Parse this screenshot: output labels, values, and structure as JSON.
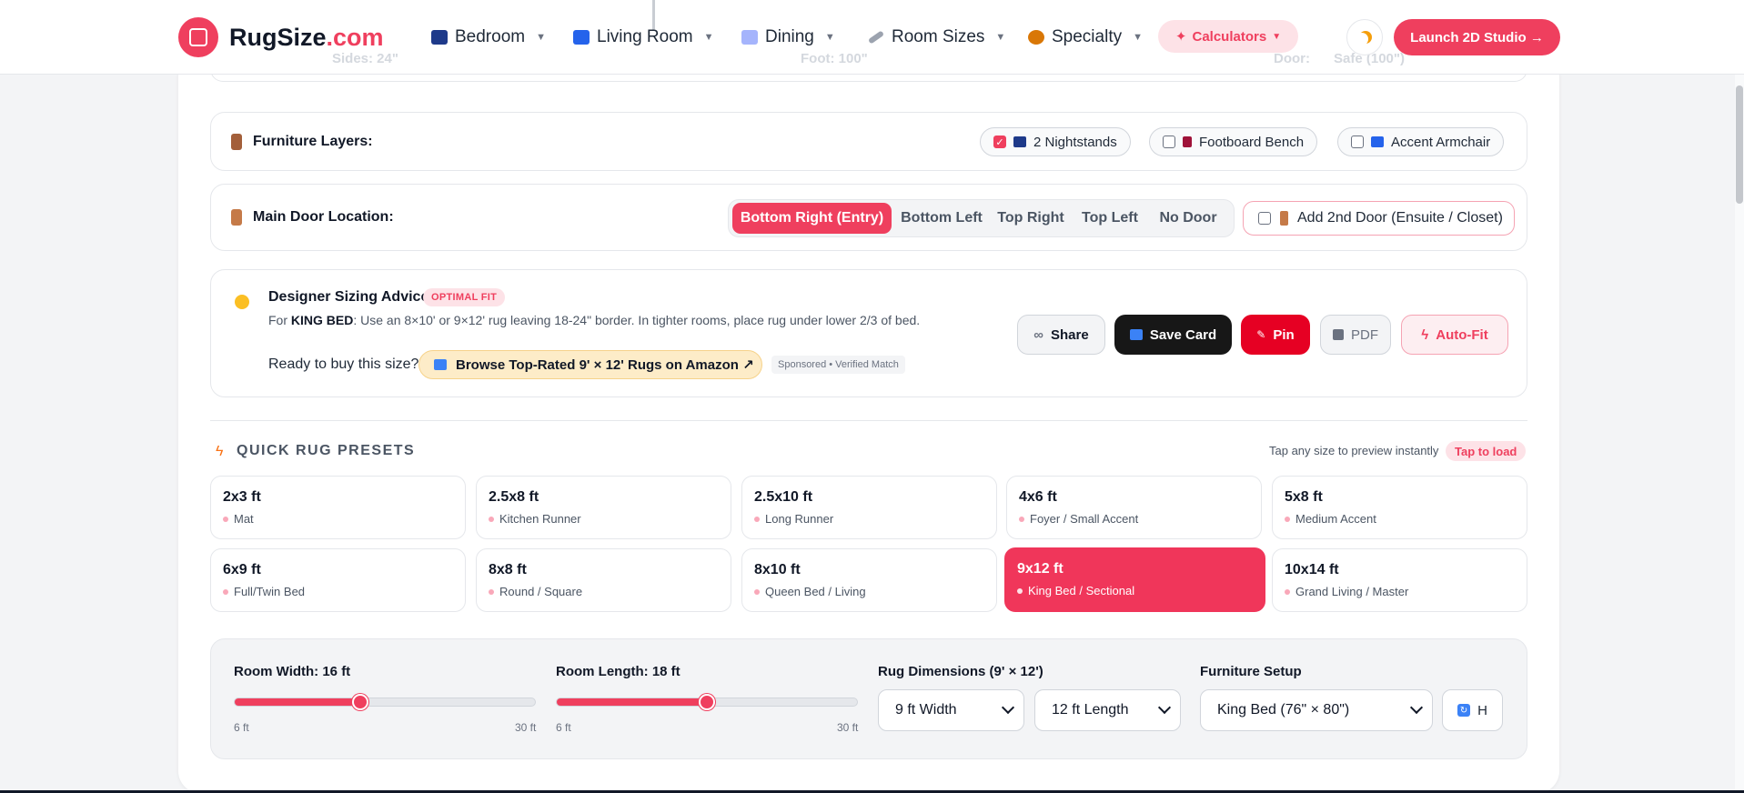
{
  "header": {
    "brand_name": "RugSize",
    "brand_suffix": ".com",
    "nav": [
      {
        "label": "Bedroom",
        "icon": "bed-icon"
      },
      {
        "label": "Living Room",
        "icon": "sofa-icon"
      },
      {
        "label": "Dining",
        "icon": "dining-icon"
      },
      {
        "label": "Room Sizes",
        "icon": "ruler-icon"
      },
      {
        "label": "Specialty",
        "icon": "specialty-icon"
      }
    ],
    "calculators_label": "Calculators",
    "launch_label": "Launch 2D Studio →",
    "background_labels": [
      "Sides: 24\"",
      "Foot: 100\"",
      "Door:",
      "Safe (100\")"
    ]
  },
  "furniture_layers": {
    "title": "Furniture Layers:",
    "items": [
      {
        "label": "2 Nightstands",
        "checked": true
      },
      {
        "label": "Footboard Bench",
        "checked": false
      },
      {
        "label": "Accent Armchair",
        "checked": false
      }
    ]
  },
  "door": {
    "title": "Main Door Location:",
    "options": [
      "Bottom Right (Entry)",
      "Bottom Left",
      "Top Right",
      "Top Left",
      "No Door"
    ],
    "selected": "Bottom Right (Entry)",
    "second_door_label": "Add 2nd Door (Ensuite / Closet)"
  },
  "advice": {
    "title": "Designer Sizing Advice",
    "badge": "OPTIMAL FIT",
    "text_prefix": "For ",
    "text_bold": "KING BED",
    "text_rest": ": Use an 8×10' or 9×12' rug leaving 18-24\" border. In tighter rooms, place rug under lower 2/3 of bed.",
    "ready_label": "Ready to buy this size?",
    "amazon_label": "Browse Top-Rated 9' × 12' Rugs on Amazon ↗",
    "sponsored_label": "Sponsored • Verified Match",
    "actions": {
      "share": "Share",
      "save": "Save Card",
      "pin": "Pin",
      "pdf": "PDF",
      "autofit": "Auto-Fit"
    }
  },
  "presets": {
    "title": "QUICK RUG PRESETS",
    "hint": "Tap any size to preview instantly",
    "tap_badge": "Tap to load",
    "items": [
      {
        "size": "2x3 ft",
        "desc": "Mat"
      },
      {
        "size": "2.5x8 ft",
        "desc": "Kitchen Runner"
      },
      {
        "size": "2.5x10 ft",
        "desc": "Long Runner"
      },
      {
        "size": "4x6 ft",
        "desc": "Foyer / Small Accent"
      },
      {
        "size": "5x8 ft",
        "desc": "Medium Accent"
      },
      {
        "size": "6x9 ft",
        "desc": "Full/Twin Bed"
      },
      {
        "size": "8x8 ft",
        "desc": "Round / Square"
      },
      {
        "size": "8x10 ft",
        "desc": "Queen Bed / Living"
      },
      {
        "size": "9x12 ft",
        "desc": "King Bed / Sectional"
      },
      {
        "size": "10x14 ft",
        "desc": "Grand Living / Master"
      }
    ],
    "selected": "9x12 ft"
  },
  "controls": {
    "room_width_label": "Room Width: 16 ft",
    "room_width_min": "6 ft",
    "room_width_max": "30 ft",
    "room_width_value": 16,
    "room_length_label": "Room Length: 18 ft",
    "room_length_min": "6 ft",
    "room_length_max": "30 ft",
    "room_length_value": 18,
    "slider_min": 6,
    "slider_max": 30,
    "rug_dims_label": "Rug Dimensions (9' × 12')",
    "rug_width_value": "9 ft Width",
    "rug_length_value": "12 ft Length",
    "furniture_label": "Furniture Setup",
    "furniture_value": "King Bed (76\" × 80\")",
    "h_button": "H"
  },
  "colors": {
    "accent": "#ef3f5e",
    "dark": "#111827",
    "pin": "#e60023"
  }
}
